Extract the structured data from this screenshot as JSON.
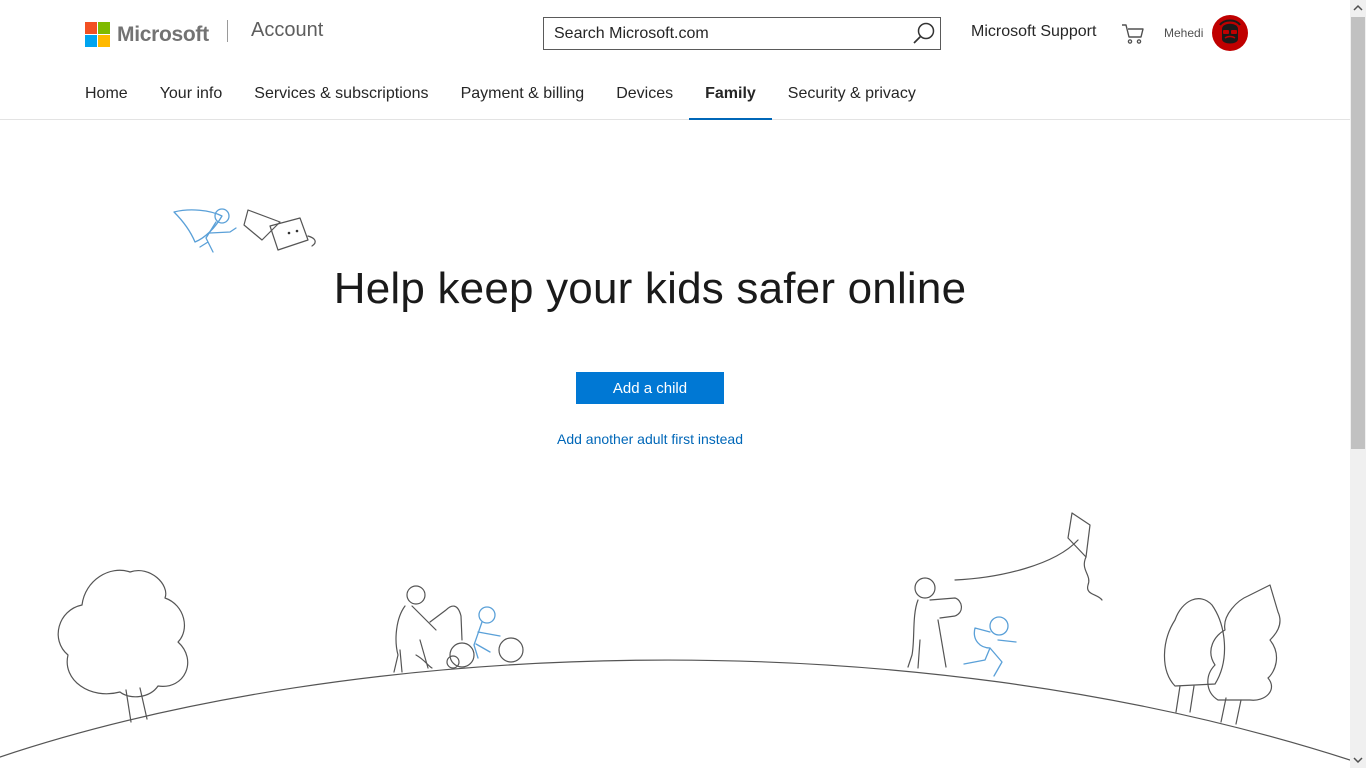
{
  "colors": {
    "accent": "#0078d4",
    "link": "#0067b8",
    "logo_red": "#f25022",
    "logo_green": "#7fba00",
    "logo_blue": "#00a4ef",
    "logo_yellow": "#ffb900",
    "avatar_bg": "#c00000",
    "illustration_child": "#5aa0d8"
  },
  "header": {
    "brand": "Microsoft",
    "product": "Account",
    "search": {
      "placeholder": "Search Microsoft.com",
      "icon": "search-icon"
    },
    "support_link": "Microsoft Support",
    "cart_icon": "cart-icon",
    "user_name": "Mehedi"
  },
  "nav": {
    "items": [
      {
        "label": "Home"
      },
      {
        "label": "Your info"
      },
      {
        "label": "Services & subscriptions"
      },
      {
        "label": "Payment & billing"
      },
      {
        "label": "Devices"
      },
      {
        "label": "Family",
        "active": true
      },
      {
        "label": "Security & privacy"
      }
    ]
  },
  "main": {
    "title": "Help keep your kids safer online",
    "primary_button": "Add a child",
    "secondary_link": "Add another adult first instead"
  }
}
